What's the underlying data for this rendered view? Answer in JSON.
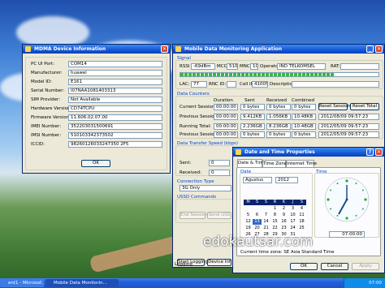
{
  "watermark": "edokautsar.com",
  "cdma": {
    "title": "MDMA Device Information",
    "rows": [
      {
        "label": "PC UI Port:",
        "value": "COM14"
      },
      {
        "label": "Manufacturer:",
        "value": "huawei"
      },
      {
        "label": "Model ID:",
        "value": "E161"
      },
      {
        "label": "Serial Number:",
        "value": "I07NAA1081403313"
      },
      {
        "label": "SIM Provider:",
        "value": "Not Available"
      },
      {
        "label": "Hardware Version:",
        "value": "CD74TCPU"
      },
      {
        "label": "Firmware Version:",
        "value": "11.606.02.07.00"
      },
      {
        "label": "IMEI Number:",
        "value": "352203031500691"
      },
      {
        "label": "IMSI Number:",
        "value": "510103342373502"
      },
      {
        "label": "ICCID:",
        "value": "98260126033247350 2F5"
      }
    ],
    "ok": "OK"
  },
  "mdm": {
    "title": "Mobile Data Monitoring Application",
    "signal": {
      "group": "Signal",
      "rssi_label": "RSSI",
      "rssi": "-69dBm",
      "mcc_label": "MCC",
      "mcc": "510",
      "mnc_label": "MNC",
      "mnc": "10",
      "operator_label": "Operator",
      "operator": "IND TELKOMSEL",
      "rat_label": "RAT:",
      "signal_level": 0.78,
      "lac_label": "LAC:",
      "lac": "77",
      "rnc_label": "RNC ID:",
      "cellid_label": "Cell ID:",
      "cellid": "41005",
      "desc_label": "Description:"
    },
    "counters": {
      "group": "Data Counters",
      "headers": [
        "Duration",
        "Sent",
        "Received",
        "Combined"
      ],
      "rows": [
        {
          "label": "Current Session:",
          "duration": "00:00:00",
          "sent": "0 bytes",
          "received": "0 bytes",
          "combined": "0 bytes"
        },
        {
          "label": "Previous Session:",
          "duration": "00:00:00",
          "sent": "9.412KB",
          "received": "1.056KB",
          "combined": "10.48KB"
        },
        {
          "label": "Running Total:",
          "duration": "00:00:00",
          "sent": "2.236GB",
          "received": "8.236GB",
          "combined": "10.48GB"
        },
        {
          "label": "Previous Session:",
          "duration": "00:00:00",
          "sent": "0 bytes",
          "received": "0 bytes",
          "combined": "0 bytes"
        }
      ],
      "reset_session": "Reset Session",
      "reset_total": "Reset Total",
      "dates": [
        "2012/07/09 07:00",
        "2012/08/09 09:57:23",
        "2012/05/09 09:57:23",
        "2012/05/09 09:57:23"
      ]
    },
    "speed": {
      "group": "Data Transfer Speed (kbps)",
      "sent_label": "Sent:",
      "sent": "0",
      "received_label": "Received:",
      "received": "0"
    },
    "connection": {
      "group": "Connection Type",
      "value": "3G Only"
    },
    "ussd": {
      "group": "USSD Commands",
      "end": "End Session",
      "send": "Send USS"
    },
    "start_logging": "Start Logging",
    "device_info": "Device Inf",
    "status": "Logging"
  },
  "datetime": {
    "title": "Date and Time Properties",
    "tabs": [
      "Date & Time",
      "Time Zone",
      "Internet Time"
    ],
    "date_group": "Date",
    "month": "Agustus",
    "year": "2012",
    "weekdays": [
      "M",
      "S",
      "S",
      "R",
      "K",
      "J",
      "S"
    ],
    "days": [
      [
        "",
        "",
        "",
        "1",
        "2",
        "3",
        "4"
      ],
      [
        "5",
        "6",
        "7",
        "8",
        "9",
        "10",
        "11"
      ],
      [
        "12",
        "13",
        "14",
        "15",
        "16",
        "17",
        "18"
      ],
      [
        "19",
        "20",
        "21",
        "22",
        "23",
        "24",
        "25"
      ],
      [
        "26",
        "27",
        "28",
        "29",
        "30",
        "31",
        ""
      ]
    ],
    "selected_day": "13",
    "time_group": "Time",
    "time": "07:00:00",
    "timezone": "Current time zone:  SE Asia Standard Time",
    "ok": "OK",
    "cancel": "Cancel",
    "apply": "Apply"
  },
  "taskbar": {
    "items": [
      "ent1 - Microsof...",
      "Mobile Data Monitorin..."
    ],
    "clock": "07:00"
  }
}
